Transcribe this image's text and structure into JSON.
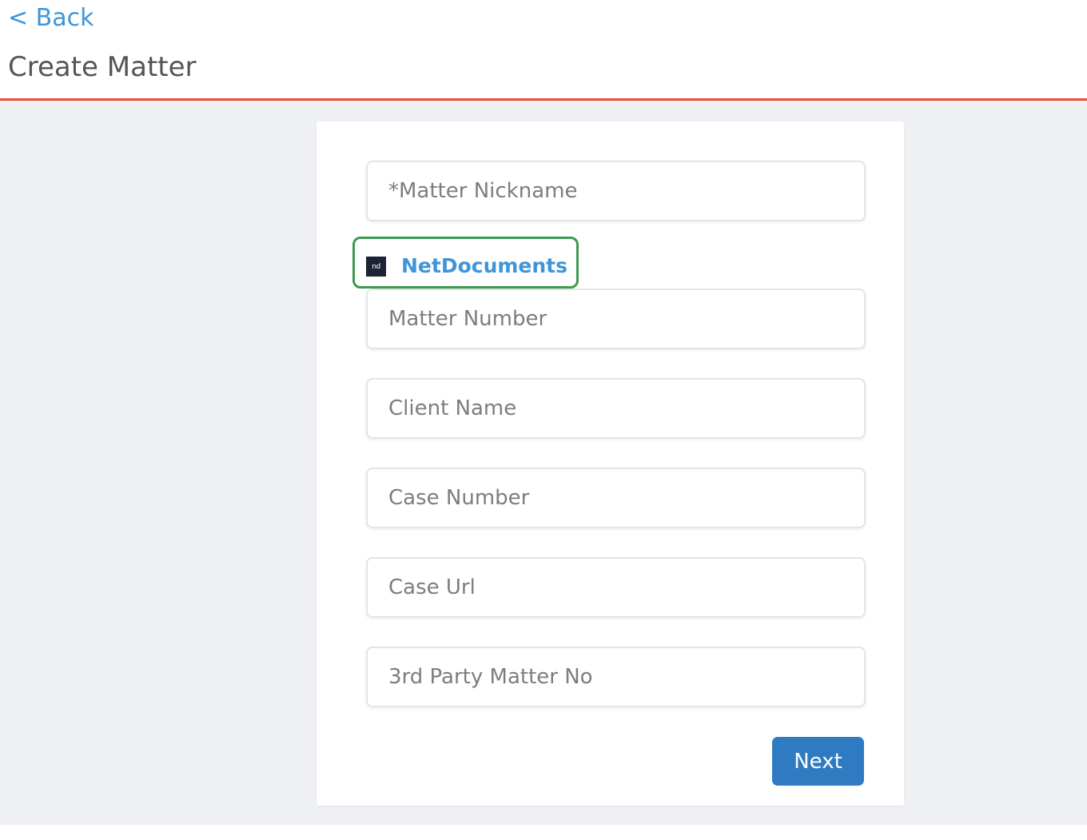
{
  "header": {
    "back_label": "< Back",
    "title": "Create Matter",
    "accent_color": "#e8503a"
  },
  "form": {
    "matter_nickname_placeholder": "*Matter Nickname",
    "integration": {
      "icon": "netdocuments-logo-icon",
      "icon_text": "nd",
      "label": "NetDocuments"
    },
    "matter_number_placeholder": "Matter Number",
    "client_name_placeholder": "Client Name",
    "case_number_placeholder": "Case Number",
    "case_url_placeholder": "Case Url",
    "third_party_matter_no_placeholder": "3rd Party Matter No",
    "next_label": "Next",
    "next_color": "#2f7bc2",
    "link_color": "#3f95d8"
  }
}
